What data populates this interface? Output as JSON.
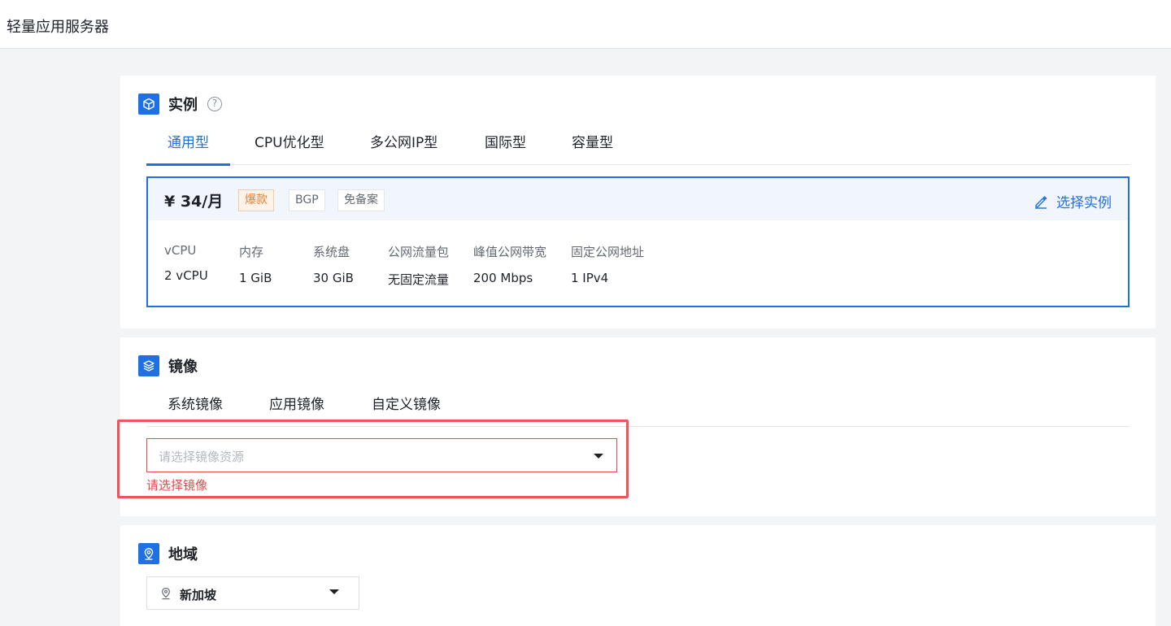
{
  "app": {
    "title": "轻量应用服务器"
  },
  "instance": {
    "title": "实例",
    "tabs": [
      {
        "label": "通用型",
        "active": true
      },
      {
        "label": "CPU优化型",
        "active": false
      },
      {
        "label": "多公网IP型",
        "active": false
      },
      {
        "label": "国际型",
        "active": false
      },
      {
        "label": "容量型",
        "active": false
      }
    ],
    "selected": {
      "price": "¥ 34/月",
      "badges": [
        "爆款",
        "BGP",
        "免备案"
      ],
      "choose_label": "选择实例",
      "specs": [
        {
          "key": "vCPU",
          "value": "2 vCPU"
        },
        {
          "key": "内存",
          "value": "1 GiB"
        },
        {
          "key": "系统盘",
          "value": "30 GiB"
        },
        {
          "key": "公网流量包",
          "value": "无固定流量"
        },
        {
          "key": "峰值公网带宽",
          "value": "200 Mbps"
        },
        {
          "key": "固定公网地址",
          "value": "1 IPv4"
        }
      ]
    }
  },
  "image": {
    "title": "镜像",
    "tabs": [
      {
        "label": "系统镜像",
        "active": false
      },
      {
        "label": "应用镜像",
        "active": false
      },
      {
        "label": "自定义镜像",
        "active": true
      }
    ],
    "select_placeholder": "请选择镜像资源",
    "error": "请选择镜像"
  },
  "region": {
    "title": "地域",
    "value": "新加坡"
  },
  "colors": {
    "accent": "#1f6fe5",
    "error": "#e5484d",
    "hot": "#ef7d2c"
  }
}
